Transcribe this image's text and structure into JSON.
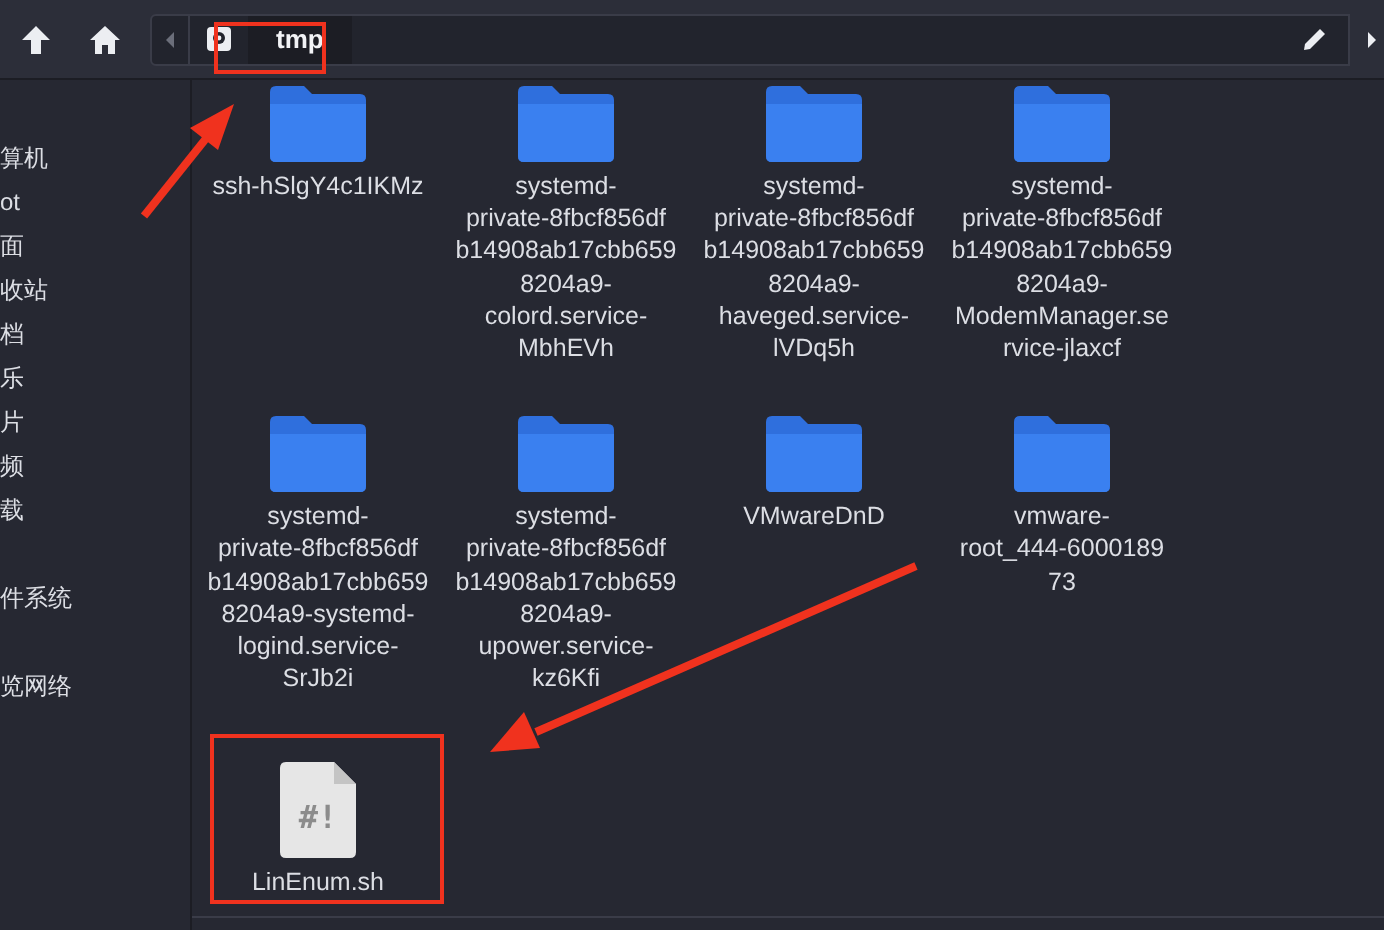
{
  "toolbar": {
    "path_segments": [
      {
        "label": "tmp",
        "selected": true
      }
    ]
  },
  "sidebar": {
    "sections": [
      [
        "算机",
        "ot",
        "面",
        "收站",
        "档",
        "乐",
        "片",
        "频",
        "载"
      ],
      [
        "件系统"
      ],
      [
        "览网络"
      ]
    ]
  },
  "files": [
    {
      "kind": "folder",
      "name_lines": [
        "ssh-hSlgY4c1IKMz"
      ]
    },
    {
      "kind": "folder",
      "name_lines": [
        "systemd-",
        "private-8fbcf856df",
        "b14908ab17cbb659",
        "8204a9-",
        "colord.service-",
        "MbhEVh"
      ]
    },
    {
      "kind": "folder",
      "name_lines": [
        "systemd-",
        "private-8fbcf856df",
        "b14908ab17cbb659",
        "8204a9-",
        "haveged.service-",
        "lVDq5h"
      ]
    },
    {
      "kind": "folder",
      "name_lines": [
        "systemd-",
        "private-8fbcf856df",
        "b14908ab17cbb659",
        "8204a9-",
        "ModemManager.se",
        "rvice-jlaxcf"
      ]
    },
    {
      "kind": "folder",
      "name_lines": [
        "systemd-",
        "private-8fbcf856df",
        "b14908ab17cbb659",
        "8204a9-systemd-",
        "logind.service-",
        "SrJb2i"
      ]
    },
    {
      "kind": "folder",
      "name_lines": [
        "systemd-",
        "private-8fbcf856df",
        "b14908ab17cbb659",
        "8204a9-",
        "upower.service-",
        "kz6Kfi"
      ]
    },
    {
      "kind": "folder",
      "name_lines": [
        "VMwareDnD"
      ]
    },
    {
      "kind": "folder",
      "name_lines": [
        "vmware-",
        "root_444-6000189",
        "73"
      ]
    },
    {
      "kind": "script",
      "name_lines": [
        "LinEnum.sh"
      ],
      "glyph": "#!"
    }
  ]
}
